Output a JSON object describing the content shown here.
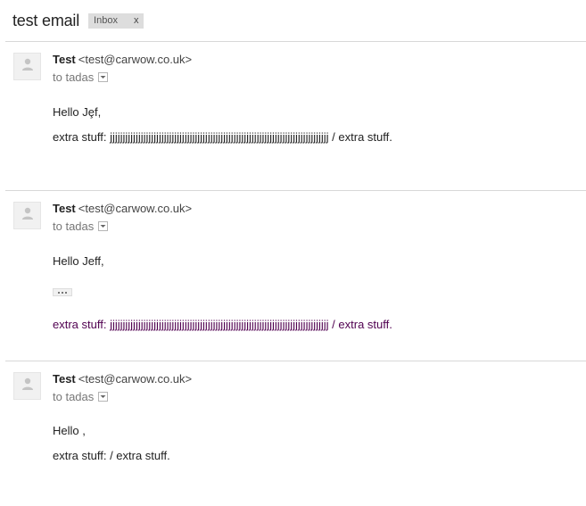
{
  "thread": {
    "subject": "test email",
    "label": "Inbox",
    "label_close": "x"
  },
  "messages": [
    {
      "sender_name": "Test",
      "sender_email": "<test@carwow.co.uk>",
      "recipient": "to tadas",
      "greeting": "Hello Jȩf,",
      "body": "extra stuff: jjjjjjjjjjjjjjjjjjjjjjjjjjjjjjjjjjjjjjjjjjjjjjjjjjjjjjjjjjjjjjjjjjjjjjjjjjjjjjjjjjjjj / extra stuff."
    },
    {
      "sender_name": "Test",
      "sender_email": "<test@carwow.co.uk>",
      "recipient": "to tadas",
      "greeting": "Hello Jeff,",
      "body": "extra stuff: jjjjjjjjjjjjjjjjjjjjjjjjjjjjjjjjjjjjjjjjjjjjjjjjjjjjjjjjjjjjjjjjjjjjjjjjjjjjjjjjjjjjj / extra stuff."
    },
    {
      "sender_name": "Test",
      "sender_email": "<test@carwow.co.uk>",
      "recipient": "to tadas",
      "greeting": "Hello ,",
      "body": "extra stuff: / extra stuff."
    }
  ],
  "colors": {
    "quoted_text": "#500050",
    "divider": "#d8d8d8",
    "label_bg": "#dddddd"
  },
  "icons": [
    "person-icon",
    "chevron-down-icon",
    "ellipsis-icon"
  ]
}
